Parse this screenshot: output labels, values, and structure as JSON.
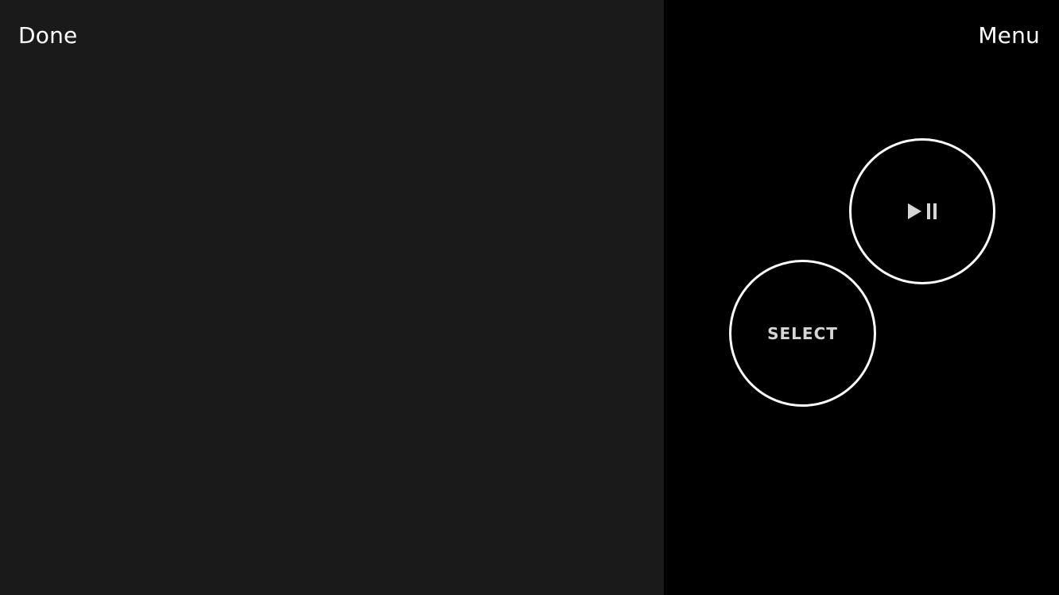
{
  "screen": {
    "background": "#000000",
    "touch_area_color": "#1a1a1a"
  },
  "top_bar": {
    "done_label": "Done",
    "menu_label": "Menu"
  },
  "controls": {
    "play_pause_icon": "play-pause-icon",
    "select_label": "SELECT"
  }
}
